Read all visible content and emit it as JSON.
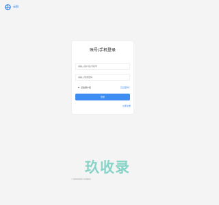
{
  "brand": {
    "name": "云图",
    "icon": "brand-logo-icon",
    "accent": "#2f80ed"
  },
  "login": {
    "title": "账号/手机登录",
    "account_placeholder": "请输入用户名/手机号",
    "password_placeholder": "请输入登录密码",
    "remember_label": "记住用户名",
    "forgot_label": "忘记密码？",
    "submit_label": "登录",
    "register_label": "立即注册"
  },
  "footer": {
    "text": "广东数码科技有限公司 版权所有"
  },
  "watermark": {
    "text": "玖收录"
  },
  "colors": {
    "background": "#f4f4f4",
    "card": "#ffffff",
    "button": "#3e8df3",
    "link": "#2f80ed",
    "watermark": "#70cdbe"
  }
}
